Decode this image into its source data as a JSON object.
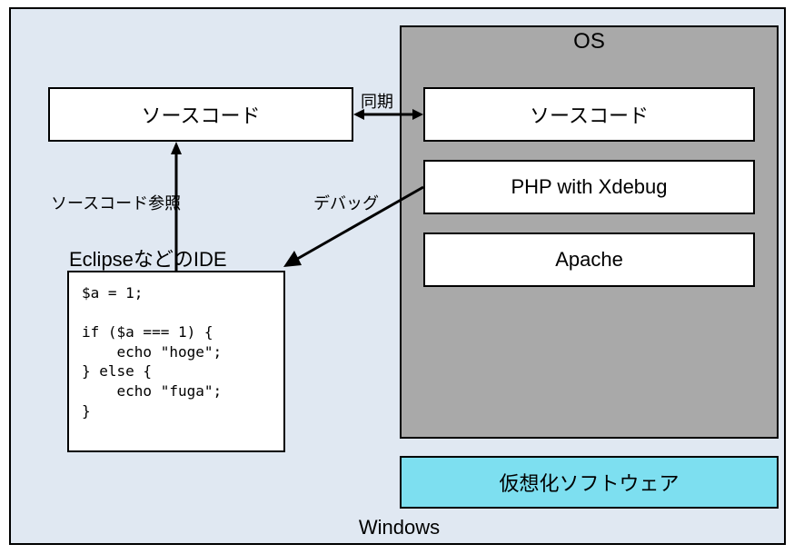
{
  "outer": {
    "label": "Windows"
  },
  "os": {
    "title": "OS",
    "source": "ソースコード",
    "php": "PHP with Xdebug",
    "apache": "Apache"
  },
  "host": {
    "source": "ソースコード",
    "ide_label": "EclipseなどのIDE",
    "code": "$a = 1;\n\nif ($a === 1) {\n    echo \"hoge\";\n} else {\n    echo \"fuga\";\n}"
  },
  "virt": {
    "label": "仮想化ソフトウェア"
  },
  "arrows": {
    "sync": "同期",
    "ref": "ソースコード参照",
    "debug": "デバッグ"
  }
}
